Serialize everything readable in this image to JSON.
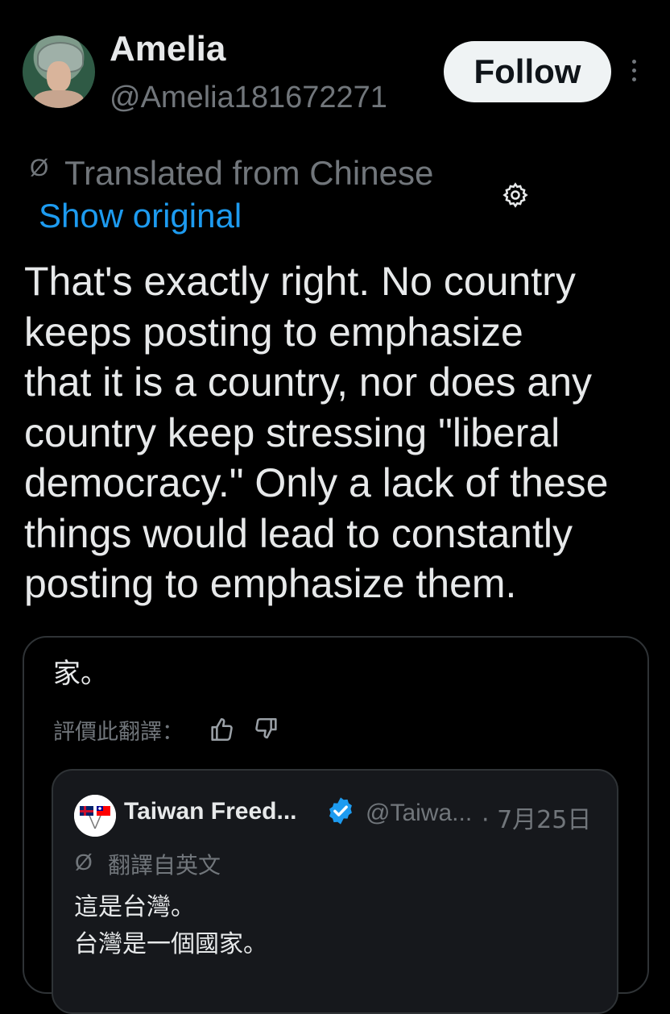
{
  "author": {
    "name": "Amelia",
    "handle": "@Amelia181672271",
    "follow_label": "Follow"
  },
  "translation": {
    "label": "Translated from Chinese",
    "show_original": "Show original"
  },
  "post": {
    "lines": [
      "That's exactly right. No country",
      "keeps posting to emphasize",
      "that it is a country, nor does any",
      "country keep stressing \"liberal",
      "democracy.\" Only a lack of these",
      "things would lead to constantly",
      "posting to emphasize them."
    ]
  },
  "card": {
    "top_text": "家。",
    "rate_label": "評價此翻譯：",
    "quoted": {
      "name": "Taiwan Freed...",
      "handle": "@Taiwa...",
      "date": "· 7月25日",
      "translation_label": "翻譯自英文",
      "line1": "這是台灣。",
      "line2": "台灣是一個國家。"
    }
  },
  "icons": {
    "menu": "more-vertical-icon",
    "settings": "gear-icon",
    "translate": "translate-slash-icon",
    "thumb_up": "thumbs-up-icon",
    "thumb_down": "thumbs-down-icon",
    "verified": "verified-badge-icon"
  },
  "colors": {
    "link": "#1d9bf0",
    "muted": "#71767b",
    "text": "#e7e9ea",
    "background": "#000000"
  }
}
